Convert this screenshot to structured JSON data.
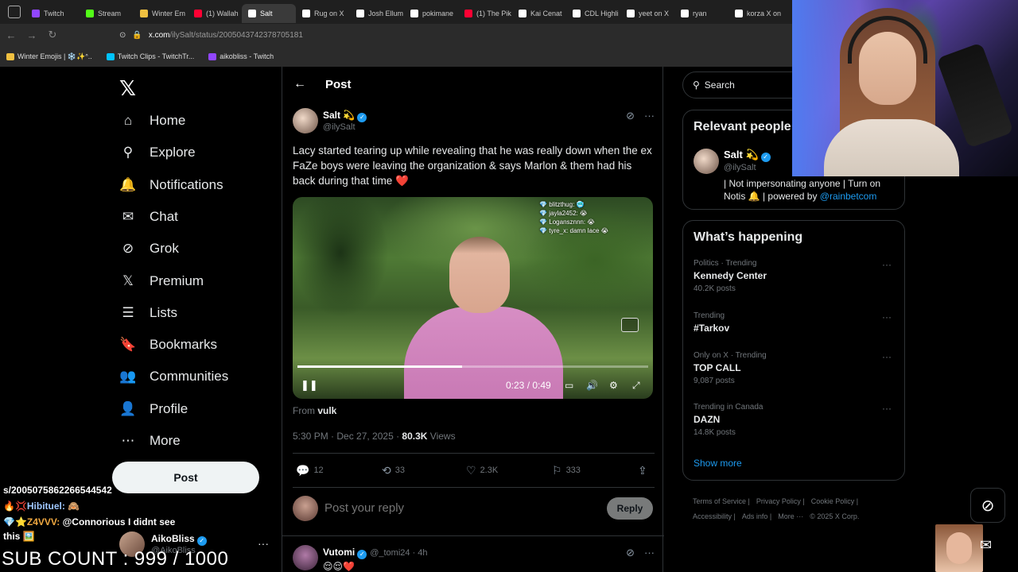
{
  "browser": {
    "tabs": [
      {
        "label": "Twitch",
        "color": "#9146ff"
      },
      {
        "label": "Stream",
        "color": "#53fc18"
      },
      {
        "label": "Winter Em",
        "color": "#f0c040"
      },
      {
        "label": "(1) Wallah",
        "color": "#ff0033"
      },
      {
        "label": "Salt",
        "color": "#ffffff"
      },
      {
        "label": "Rug on X",
        "color": "#ffffff"
      },
      {
        "label": "Josh Ellum",
        "color": "#ffffff"
      },
      {
        "label": "pokimane",
        "color": "#ffffff"
      },
      {
        "label": "(1) The Pik",
        "color": "#ff0033"
      },
      {
        "label": "Kai Cenat",
        "color": "#ffffff"
      },
      {
        "label": "CDL Highli",
        "color": "#ffffff"
      },
      {
        "label": "yeet on X",
        "color": "#ffffff"
      },
      {
        "label": "ryan",
        "color": "#ffffff"
      },
      {
        "label": "korza X on",
        "color": "#ffffff"
      }
    ],
    "active_tab_index": 4,
    "url_host": "x.com",
    "url_path": "/ilySalt/status/2005043742378705181",
    "bookmarks": [
      {
        "label": "Winter Emojis | ❄️✨ᐢ..",
        "color": "#f0c040"
      },
      {
        "label": "Twitch Clips - TwitchTr...",
        "color": "#00c3ff"
      },
      {
        "label": "aikobliss - Twitch",
        "color": "#9146ff"
      }
    ]
  },
  "nav": {
    "logo": "𝕏",
    "items": [
      {
        "label": "Home",
        "icon": "home-icon",
        "glyph": "⌂"
      },
      {
        "label": "Explore",
        "icon": "search-icon",
        "glyph": "⚲"
      },
      {
        "label": "Notifications",
        "icon": "bell-icon",
        "glyph": "🔔"
      },
      {
        "label": "Chat",
        "icon": "mail-icon",
        "glyph": "✉"
      },
      {
        "label": "Grok",
        "icon": "grok-icon",
        "glyph": "⊘"
      },
      {
        "label": "Premium",
        "icon": "x-premium-icon",
        "glyph": "𝕏"
      },
      {
        "label": "Lists",
        "icon": "list-icon",
        "glyph": "☰"
      },
      {
        "label": "Bookmarks",
        "icon": "bookmark-icon",
        "glyph": "🔖"
      },
      {
        "label": "Communities",
        "icon": "communities-icon",
        "glyph": "👥"
      },
      {
        "label": "Profile",
        "icon": "profile-icon",
        "glyph": "👤"
      },
      {
        "label": "More",
        "icon": "more-icon",
        "glyph": "⋯"
      }
    ],
    "post_button": "Post"
  },
  "account": {
    "name": "AikoBliss",
    "handle": "@AikoBliss"
  },
  "main": {
    "header_title": "Post",
    "tweet": {
      "name": "Salt 💫",
      "handle": "@ilySalt",
      "text": "Lacy started tearing up while revealing that he was really down when the ex FaZe boys were leaving the organization & says Marlon & them had his back during that time",
      "text_emoji": "❤️",
      "video": {
        "current_time": "0:23",
        "duration": "0:49",
        "progress": 0.47,
        "chat_lines": [
          "💎 blitzthug: 🥶",
          "💎 jayla2452: 😭",
          "💎 Logansznnn: 😭",
          "💎 tyre_x: damn lace 😭"
        ]
      },
      "from_prefix": "From",
      "from_name": "vulk",
      "time": "5:30 PM · Dec 27, 2025 ·",
      "views_count": "80.3K",
      "views_label": "Views",
      "replies": "12",
      "reposts": "33",
      "likes": "2.3K",
      "bookmarks": "333"
    },
    "reply_placeholder": "Post your reply",
    "reply_button": "Reply",
    "reply2": {
      "name": "Vutomi",
      "handle": "@_tomi24 · 4h",
      "text": "😌😌❤️"
    }
  },
  "right": {
    "search_placeholder": "Search",
    "relevant": {
      "title": "Relevant people",
      "name": "Salt 💫",
      "handle": "@ilySalt",
      "bio": "| Not impersonating anyone | Turn on Notis 🔔 | powered by",
      "bio_link": "@rainbetcom"
    },
    "happening": {
      "title": "What’s happening",
      "trends": [
        {
          "category": "Politics · Trending",
          "name": "Kennedy Center",
          "count": "40.2K posts"
        },
        {
          "category": "Trending",
          "name": "#Tarkov",
          "count": ""
        },
        {
          "category": "Only on X · Trending",
          "name": "TOP CALL",
          "count": "9,087 posts"
        },
        {
          "category": "Trending in Canada",
          "name": "DAZN",
          "count": "14.8K posts"
        }
      ],
      "show_more": "Show more"
    },
    "footer": [
      "Terms of Service |",
      "Privacy Policy |",
      "Cookie Policy |",
      "Accessibility |",
      "Ads info |",
      "More ···",
      "© 2025 X Corp."
    ]
  },
  "overlay": {
    "chat": [
      {
        "name": "",
        "text": "s/2005075862266544542"
      },
      {
        "name": "🔥💢Hibituel:",
        "text": "🙈"
      },
      {
        "name": "💎⭐Z4VVV:",
        "text": "@Connorious I didnt see"
      },
      {
        "name": "",
        "text": "this 🖼️"
      }
    ],
    "sub_count": "SUB COUNT : 999 / 1000"
  }
}
